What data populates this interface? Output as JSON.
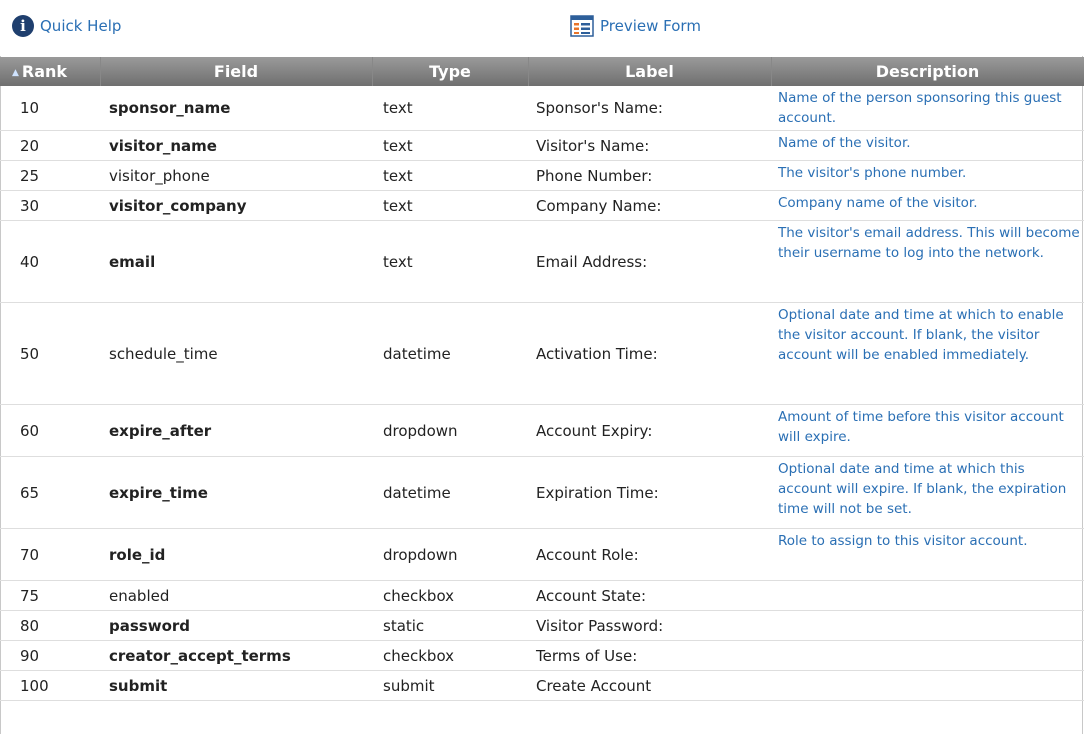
{
  "toolbar": {
    "quick_help": "Quick Help",
    "preview_form": "Preview Form"
  },
  "columns": {
    "rank": "Rank",
    "field": "Field",
    "type": "Type",
    "label": "Label",
    "description": "Description"
  },
  "sort": {
    "column": "rank",
    "direction": "ascending"
  },
  "rows": [
    {
      "rank": "10",
      "field": "sponsor_name",
      "bold": true,
      "type": "text",
      "label": "Sponsor's Name:",
      "description": "Name of the person sponsoring this guest account."
    },
    {
      "rank": "20",
      "field": "visitor_name",
      "bold": true,
      "type": "text",
      "label": "Visitor's Name:",
      "description": "Name of the visitor."
    },
    {
      "rank": "25",
      "field": "visitor_phone",
      "bold": false,
      "type": "text",
      "label": "Phone Number:",
      "description": "The visitor's phone number."
    },
    {
      "rank": "30",
      "field": "visitor_company",
      "bold": true,
      "type": "text",
      "label": "Company Name:",
      "description": "Company name of the visitor."
    },
    {
      "rank": "40",
      "field": "email",
      "bold": true,
      "type": "text",
      "label": "Email Address:",
      "description": "The visitor's email address. This will become their username to log into the network."
    },
    {
      "rank": "50",
      "field": "schedule_time",
      "bold": false,
      "type": "datetime",
      "label": "Activation Time:",
      "description": "Optional date and time at which to enable the visitor account. If blank, the visitor account will be enabled immediately."
    },
    {
      "rank": "60",
      "field": "expire_after",
      "bold": true,
      "type": "dropdown",
      "label": "Account Expiry:",
      "description": "Amount of time before this visitor account will expire."
    },
    {
      "rank": "65",
      "field": "expire_time",
      "bold": true,
      "type": "datetime",
      "label": "Expiration Time:",
      "description": "Optional date and time at which this account will expire. If blank, the expiration time will not be set."
    },
    {
      "rank": "70",
      "field": "role_id",
      "bold": true,
      "type": "dropdown",
      "label": "Account Role:",
      "description": "Role to assign to this visitor account."
    },
    {
      "rank": "75",
      "field": "enabled",
      "bold": false,
      "type": "checkbox",
      "label": "Account State:",
      "description": ""
    },
    {
      "rank": "80",
      "field": "password",
      "bold": true,
      "type": "static",
      "label": "Visitor Password:",
      "description": ""
    },
    {
      "rank": "90",
      "field": "creator_accept_terms",
      "bold": true,
      "type": "checkbox",
      "label": "Terms of Use:",
      "description": ""
    },
    {
      "rank": "100",
      "field": "submit",
      "bold": true,
      "type": "submit",
      "label": "Create Account",
      "description": ""
    }
  ],
  "colors": {
    "link": "#2a6fb4",
    "header_bg": "#7f7f7f",
    "info_icon": "#1f3f6e"
  }
}
